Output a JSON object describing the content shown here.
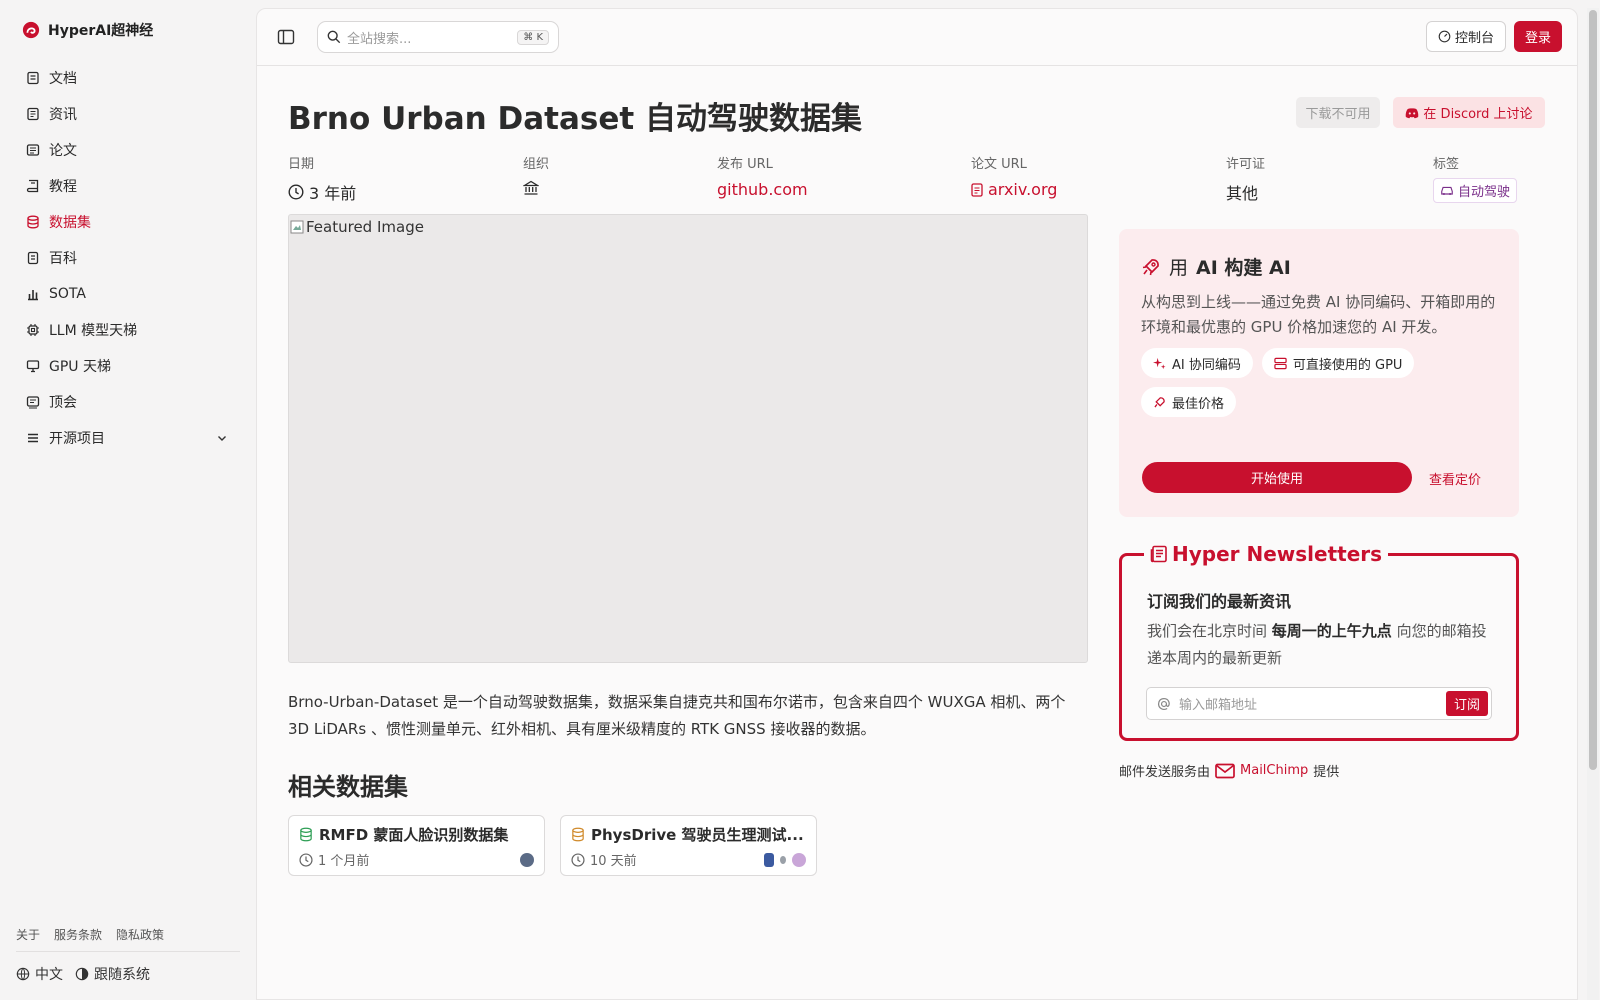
{
  "brand": {
    "name": "HyperAI超神经"
  },
  "sidebar": {
    "items": [
      {
        "label": "文档",
        "icon": "doc-icon",
        "active": false
      },
      {
        "label": "资讯",
        "icon": "news-icon",
        "active": false
      },
      {
        "label": "论文",
        "icon": "paper-icon",
        "active": false
      },
      {
        "label": "教程",
        "icon": "book-icon",
        "active": false
      },
      {
        "label": "数据集",
        "icon": "database-icon",
        "active": true
      },
      {
        "label": "百科",
        "icon": "wiki-icon",
        "active": false
      },
      {
        "label": "SOTA",
        "icon": "chart-icon",
        "active": false
      },
      {
        "label": "LLM 模型天梯",
        "icon": "chip-icon",
        "active": false
      },
      {
        "label": "GPU 天梯",
        "icon": "monitor-icon",
        "active": false
      },
      {
        "label": "顶会",
        "icon": "conference-icon",
        "active": false
      },
      {
        "label": "开源项目",
        "icon": "list-icon",
        "active": false
      }
    ],
    "footer_links": [
      "关于",
      "服务条款",
      "隐私政策"
    ],
    "language": "中文",
    "theme": "跟随系统"
  },
  "topbar": {
    "search_placeholder": "全站搜索...",
    "search_shortcut": "K",
    "console_label": "控制台",
    "login_label": "登录"
  },
  "page": {
    "title": "Brno Urban Dataset 自动驾驶数据集",
    "download_label": "下载不可用",
    "discord_label": "在 Discord 上讨论",
    "meta": {
      "date_label": "日期",
      "date_value": "3 年前",
      "org_label": "组织",
      "release_url_label": "发布 URL",
      "release_url_value": "github.com",
      "paper_url_label": "论文 URL",
      "paper_url_value": "arxiv.org",
      "license_label": "许可证",
      "license_value": "其他",
      "tags_label": "标签",
      "tag_value": "自动驾驶"
    },
    "featured_image_alt": "Featured Image",
    "description": "Brno-Urban-Dataset 是一个自动驾驶数据集，数据采集自捷克共和国布尔诺市，包含来自四个 WUXGA 相机、两个 3D LiDARs 、惯性测量单元、红外相机、具有厘米级精度的 RTK GNSS 接收器的数据。",
    "related_heading": "相关数据集",
    "related": [
      {
        "title": "RMFD 蒙面人脸识别数据集",
        "time": "1 个月前",
        "icon_color": "#2e9e55"
      },
      {
        "title": "PhysDrive 驾驶员生理测试...",
        "time": "10 天前",
        "icon_color": "#d08a2b"
      }
    ]
  },
  "promo": {
    "title_prefix": "用",
    "title_bold": "AI 构建 AI",
    "text": "从构思到上线——通过免费 AI 协同编码、开箱即用的环境和最优惠的 GPU 价格加速您的 AI 开发。",
    "chips": [
      "AI 协同编码",
      "可直接使用的 GPU",
      "最佳价格"
    ],
    "start_label": "开始使用",
    "pricing_label": "查看定价"
  },
  "newsletter": {
    "title": "Hyper Newsletters",
    "subtitle": "订阅我们的最新资讯",
    "text_before": "我们会在北京时间 ",
    "text_bold": "每周一的上午九点",
    "text_after": " 向您的邮箱投递本周内的最新更新",
    "email_placeholder": "输入邮箱地址",
    "subscribe_label": "订阅",
    "provider_prefix": "邮件发送服务由",
    "provider_name": "MailChimp",
    "provider_suffix": "提供"
  },
  "colors": {
    "accent": "#c8102e",
    "promo_bg": "#fcecee"
  }
}
